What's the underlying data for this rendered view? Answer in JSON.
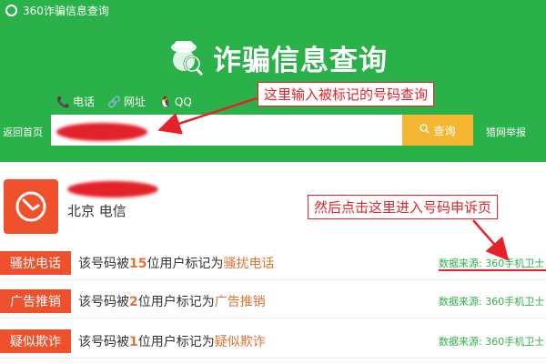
{
  "top_bar": {
    "title": "360诈骗信息查询"
  },
  "brand": {
    "title": "诈骗信息查询"
  },
  "search_tabs": [
    {
      "icon": "phone-icon",
      "glyph": "📞",
      "label": "电话"
    },
    {
      "icon": "link-icon",
      "glyph": "🔗",
      "label": "网址"
    },
    {
      "icon": "qq-icon",
      "glyph": "🐧",
      "label": "QQ"
    }
  ],
  "nav": {
    "back_home": "返回首页",
    "report": "猎网举报"
  },
  "search": {
    "placeholder": "",
    "button_label": "查询"
  },
  "annotations": {
    "callout_search": "这里输入被标记的号码查询",
    "callout_complain": "然后点击这里进入号码申诉页"
  },
  "phone": {
    "location": "北京 电信"
  },
  "tags": [
    {
      "badge": "骚扰电话",
      "prefix": "该号码被",
      "count": "15",
      "middle": "位用户标记为",
      "label": "骚扰电话",
      "source": "数据来源: 360手机卫士"
    },
    {
      "badge": "广告推销",
      "prefix": "该号码被",
      "count": "2",
      "middle": "位用户标记为",
      "label": "广告推销",
      "source": "数据来源: 360手机卫士"
    },
    {
      "badge": "疑似欺诈",
      "prefix": "该号码被",
      "count": "1",
      "middle": "位用户标记为",
      "label": "疑似欺诈",
      "source": "数据来源: 360手机卫士"
    }
  ],
  "colors": {
    "brand_green": "#2bb14a",
    "accent_orange": "#f0512d",
    "search_yellow": "#f5b731",
    "annotation_red": "#e5222a"
  }
}
